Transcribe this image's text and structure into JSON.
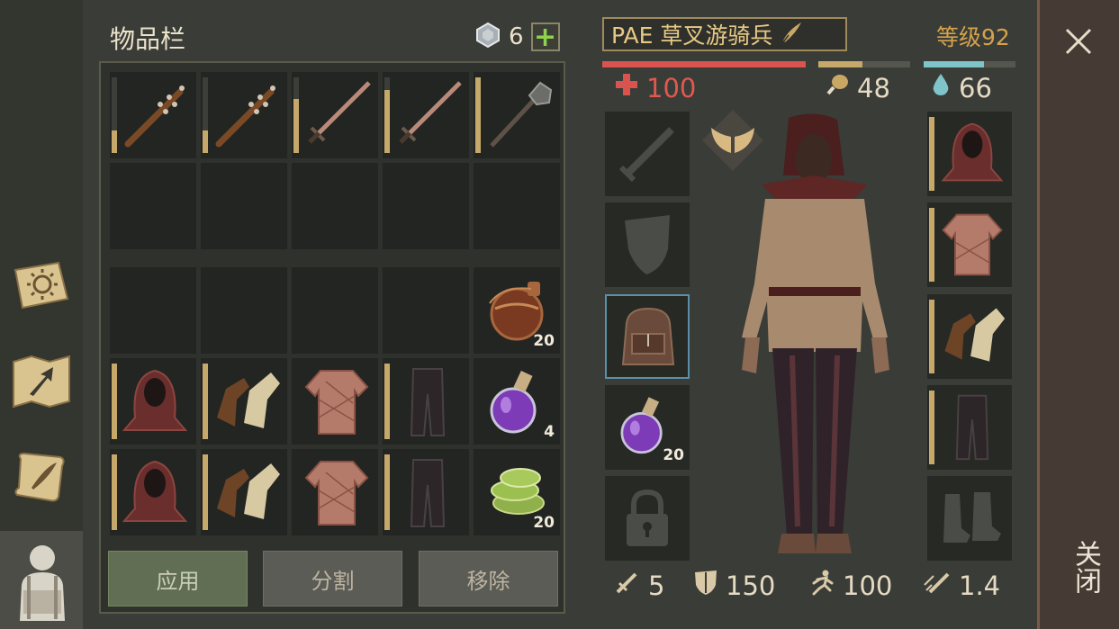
{
  "inventory": {
    "title": "物品栏",
    "currency_count": "6",
    "add_label": "+",
    "row1": [
      {
        "icon": "spiked-club-icon",
        "durability": 0.3
      },
      {
        "icon": "spiked-club-icon",
        "durability": 0.3
      },
      {
        "icon": "sword-icon",
        "durability": 0.7
      },
      {
        "icon": "sword-icon",
        "durability": 0.8
      },
      {
        "icon": "mace-icon",
        "durability": 1.0
      }
    ],
    "flask_qty": "20",
    "potion_qty": "4",
    "herbs_qty": "20",
    "buttons": {
      "apply": "应用",
      "split": "分割",
      "remove": "移除"
    }
  },
  "character": {
    "name": "PAE 草叉游骑兵",
    "level_label": "等级92",
    "health": "100",
    "hunger": "48",
    "thirst": "66",
    "health_fill": 1.0,
    "hunger_fill": 0.48,
    "thirst_fill": 0.66,
    "equipped_potion_qty": "20",
    "stats": {
      "attack": "5",
      "armor": "150",
      "speed": "100",
      "attack_speed": "1.4"
    }
  },
  "close": {
    "label": "关闭"
  },
  "colors": {
    "health": "#d9534f",
    "hunger": "#c5a86a",
    "thirst": "#7fc4c8",
    "accent_gold": "#d4a24c"
  }
}
